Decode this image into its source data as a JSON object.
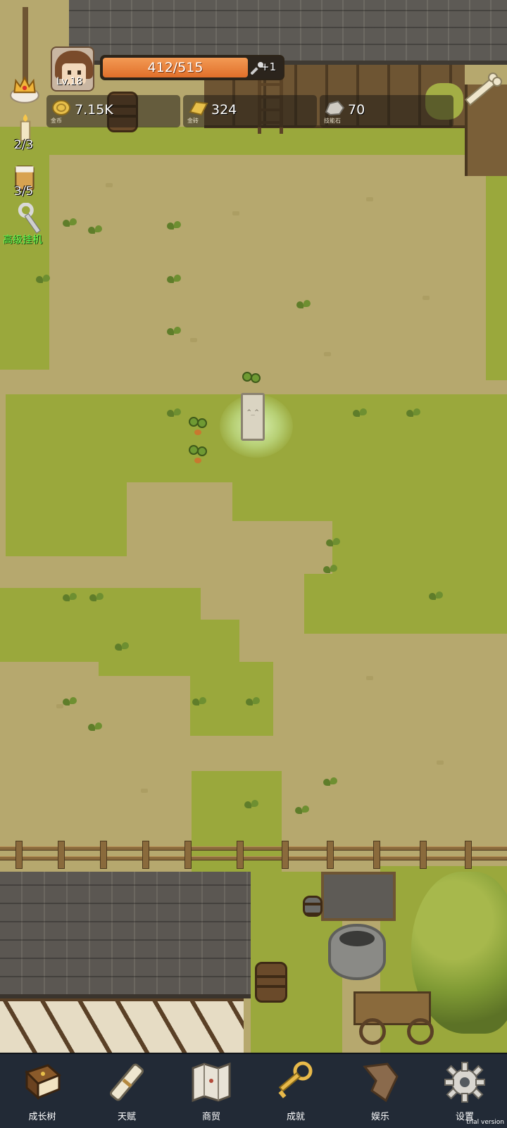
{
  "player": {
    "level_label": "Lv.18",
    "hp_text": "412/515",
    "hp_fraction": 0.8,
    "regen_label": "+1"
  },
  "resources": [
    {
      "name": "gold",
      "value": "7.15K",
      "caption": "金币",
      "icon": "gold-coin-icon"
    },
    {
      "name": "gold-brick",
      "value": "324",
      "caption": "金砖",
      "icon": "gold-bar-icon"
    },
    {
      "name": "skill-stone",
      "value": "70",
      "caption": "技能石",
      "icon": "skill-stone-icon"
    }
  ],
  "side": {
    "candle_count": "2/3",
    "beer_count": "3/5",
    "idle_label": "高级挂机"
  },
  "nav": {
    "items": [
      {
        "label": "成长树",
        "icon": "book-icon"
      },
      {
        "label": "天赋",
        "icon": "scroll-icon"
      },
      {
        "label": "商贸",
        "icon": "map-icon"
      },
      {
        "label": "成就",
        "icon": "key-icon"
      },
      {
        "label": "娱乐",
        "icon": "parchment-icon"
      },
      {
        "label": "设置",
        "icon": "gear-icon"
      }
    ]
  },
  "watermark": "trial version",
  "colors": {
    "hp_fill": "#e06f2a",
    "grass": "#9aa83c",
    "dirt": "#b6a86e",
    "nav_bg": "#222a36",
    "idle_label": "#5cff52"
  }
}
